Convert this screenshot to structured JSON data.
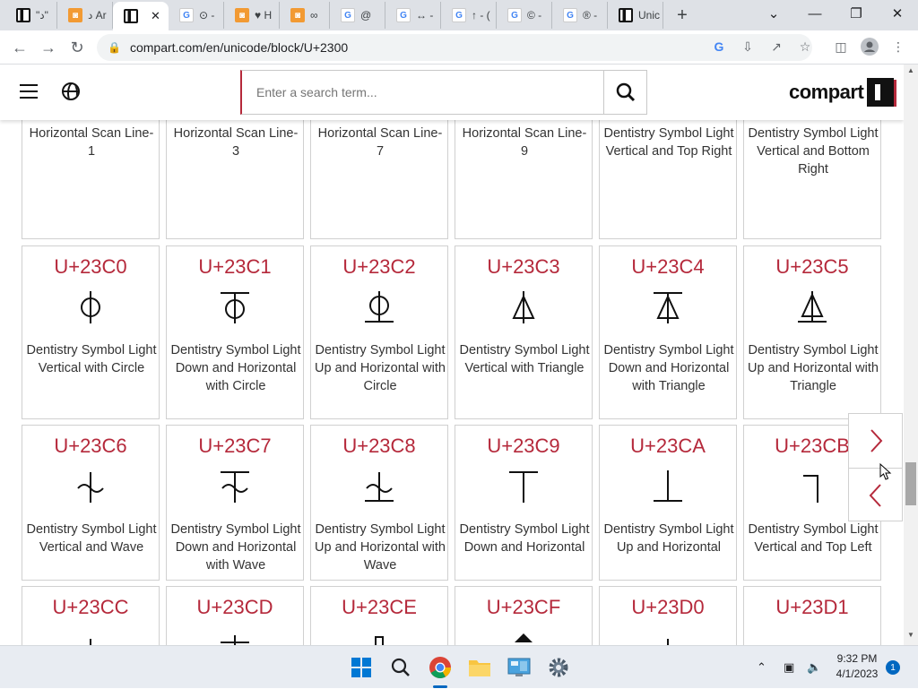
{
  "browser": {
    "tabs": [
      {
        "icon": "compart-favicon",
        "label": "\"د\""
      },
      {
        "icon": "orange-favicon",
        "label": "د Ar"
      },
      {
        "icon": "compart-favicon",
        "label": "",
        "active": true
      },
      {
        "icon": "google-favicon",
        "label": "⊙ -"
      },
      {
        "icon": "orange-favicon",
        "label": "♥ H"
      },
      {
        "icon": "orange-favicon",
        "label": "∞"
      },
      {
        "icon": "google-favicon",
        "label": "@"
      },
      {
        "icon": "google-favicon",
        "label": "↔ -"
      },
      {
        "icon": "google-favicon",
        "label": "↑ - ("
      },
      {
        "icon": "google-favicon",
        "label": "© -"
      },
      {
        "icon": "google-favicon",
        "label": "® -"
      },
      {
        "icon": "compart-favicon",
        "label": "Unic"
      }
    ],
    "tab_close": "✕",
    "new_tab": "+",
    "url": "compart.com/en/unicode/block/U+2300"
  },
  "site": {
    "search_placeholder": "Enter a search term...",
    "logo_text": "compart"
  },
  "cards_top": [
    {
      "name": "Horizontal Scan Line-1"
    },
    {
      "name": "Horizontal Scan Line-3"
    },
    {
      "name": "Horizontal Scan Line-7"
    },
    {
      "name": "Horizontal Scan Line-9"
    },
    {
      "name": "Dentistry Symbol Light Vertical and Top Right"
    },
    {
      "name": "Dentistry Symbol Light Vertical and Bottom Right"
    }
  ],
  "cards_row2": [
    {
      "code": "U+23C0",
      "name": "Dentistry Symbol Light Vertical with Circle"
    },
    {
      "code": "U+23C1",
      "name": "Dentistry Symbol Light Down and Horizontal with Circle"
    },
    {
      "code": "U+23C2",
      "name": "Dentistry Symbol Light Up and Horizontal with Circle"
    },
    {
      "code": "U+23C3",
      "name": "Dentistry Symbol Light Vertical with Triangle"
    },
    {
      "code": "U+23C4",
      "name": "Dentistry Symbol Light Down and Horizontal with Triangle"
    },
    {
      "code": "U+23C5",
      "name": "Dentistry Symbol Light Up and Horizontal with Triangle"
    }
  ],
  "cards_row3": [
    {
      "code": "U+23C6",
      "name": "Dentistry Symbol Light Vertical and Wave"
    },
    {
      "code": "U+23C7",
      "name": "Dentistry Symbol Light Down and Horizontal with Wave"
    },
    {
      "code": "U+23C8",
      "name": "Dentistry Symbol Light Up and Horizontal with Wave"
    },
    {
      "code": "U+23C9",
      "name": "Dentistry Symbol Light Down and Horizontal"
    },
    {
      "code": "U+23CA",
      "name": "Dentistry Symbol Light Up and Horizontal"
    },
    {
      "code": "U+23CB",
      "name": "Dentistry Symbol Light Vertical and Top Left"
    }
  ],
  "cards_row4": [
    {
      "code": "U+23CC"
    },
    {
      "code": "U+23CD"
    },
    {
      "code": "U+23CE"
    },
    {
      "code": "U+23CF"
    },
    {
      "code": "U+23D0"
    },
    {
      "code": "U+23D1"
    }
  ],
  "taskbar": {
    "time": "9:32 PM",
    "date": "4/1/2023",
    "notification_count": "1"
  },
  "colors": {
    "accent": "#b5293b",
    "tab_strip": "#dee1e6",
    "taskbar": "#e8ecf2"
  }
}
